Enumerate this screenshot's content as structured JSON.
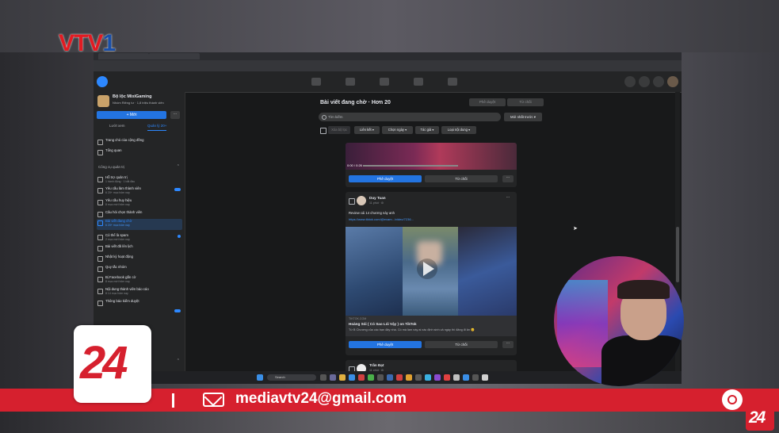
{
  "broadcast": {
    "channel_logo": "VTV1",
    "email": "mediavtv24@gmail.com",
    "program_logo": "24"
  },
  "sidebar": {
    "group_name": "Bộ lộc MixiGaming",
    "group_meta": "Nhóm Riêng tư · 1,8 triệu thành viên",
    "new_label": "+ Mới",
    "more_label": "···",
    "tabs": [
      "Lướt xem",
      "Quản lý 20+"
    ],
    "top_items": [
      {
        "label": "Trang chủ của cộng đồng"
      },
      {
        "label": "Tổng quan"
      }
    ],
    "section_title": "Công cụ quản trị",
    "admin_items": [
      {
        "label": "Hỗ trợ quản trị",
        "sub": "1 hành động · 1 bắt đầu"
      },
      {
        "label": "Yêu cầu làm thành viên",
        "sub": "6 20+ mục hôm nay"
      },
      {
        "label": "Yêu cầu huy hiệu",
        "sub": "8 mục mới hôm nay"
      },
      {
        "label": "Câu hỏi chọn thành viên",
        "sub": ""
      },
      {
        "label": "Bài viết đang chờ",
        "sub": "6 20+ mục hôm nay"
      },
      {
        "label": "Có thể là spam",
        "sub": "2 mục mới hôm nay"
      },
      {
        "label": "Bài viết đã lên lịch",
        "sub": ""
      },
      {
        "label": "Nhật ký hoạt động",
        "sub": ""
      },
      {
        "label": "Quy tắc nhóm",
        "sub": ""
      },
      {
        "label": "Bị Facebook gắn cờ",
        "sub": "8 mục mới hôm nay"
      },
      {
        "label": "Nội dung thành viên báo cáo",
        "sub": "8 14 mục hôm nay"
      },
      {
        "label": "Thông báo kiểm duyệt",
        "sub": ""
      }
    ]
  },
  "main": {
    "title": "Bài viết đang chờ · Hơn 20",
    "approve_all": "Phê duyệt",
    "reject_all": "Từ chối",
    "search_placeholder": "Tìm kiếm",
    "sort_label": "Mới nhất trước ▾",
    "filters": [
      "Xóa bộ lọc",
      "Liên kết ▾",
      "Chọn ngày ▾",
      "Tác giả ▾",
      "Loại nội dung ▾"
    ]
  },
  "posts": [
    {
      "video_time": "0:00 / 0:26",
      "approve": "Phê duyệt",
      "reject": "Từ chối",
      "more": "···"
    },
    {
      "author": "Duy Tuan",
      "time": "11 phút · ⚙",
      "text": "Review cái 14 chương này anh",
      "link": "https://www.tiktok.com/@exam.../video/7236...",
      "link_domain": "TIKTOK.COM",
      "link_title": "Hoàng Sói ( Có Sao Lói Vậy ) on TikTok",
      "link_desc": "Từ B Chương của các bạn đây nhá. Có mà làm này ai xác định sinh cả ngày thì đảng đi ăn 😊",
      "approve": "Phê duyệt",
      "reject": "Từ chối",
      "more": "···"
    },
    {
      "author": "Trần Đạt",
      "time": "11 phút · ⚙"
    }
  ],
  "taskbar": {
    "search_label": "Search"
  },
  "colors": {
    "accent": "#2374e1",
    "banner_red": "#d6202e",
    "fb_dark": "#18191a"
  }
}
